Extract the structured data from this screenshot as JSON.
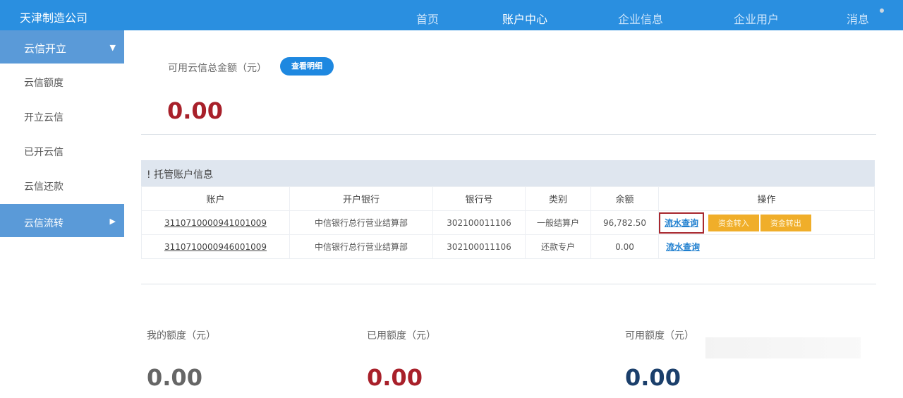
{
  "header": {
    "company": "天津制造公司",
    "nav": [
      "首页",
      "账户中心",
      "企业信息",
      "企业用户",
      "消息"
    ]
  },
  "sidebar": {
    "section": "云信开立",
    "items": [
      "云信额度",
      "开立云信",
      "已开云信",
      "云信还款"
    ],
    "active": "云信流转"
  },
  "summary": {
    "label": "可用云信总金额（元）",
    "detail_button": "查看明细",
    "amount": "0.00"
  },
  "accounts": {
    "title": "托管账户信息",
    "columns": [
      "账户",
      "开户银行",
      "银行号",
      "类别",
      "余额",
      "操作"
    ],
    "rows": [
      {
        "account": "3110710000941001009",
        "bank": "中信银行总行营业结算部",
        "bank_no": "302100011106",
        "type": "一般结算户",
        "balance": "96,782.50",
        "actions": [
          "流水查询",
          "资金转入",
          "资金转出"
        ]
      },
      {
        "account": "3110710000946001009",
        "bank": "中信银行总行营业结算部",
        "bank_no": "302100011106",
        "type": "还款专户",
        "balance": "0.00",
        "actions": [
          "流水查询"
        ]
      }
    ]
  },
  "quota": {
    "mine_label": "我的额度（元）",
    "mine": "0.00",
    "used_label": "已用额度（元）",
    "used": "0.00",
    "avail_label": "可用额度（元）",
    "avail": "0.00"
  },
  "colors": {
    "header": "#2a8fe0",
    "red": "#a8202a",
    "navy": "#1b3f6b",
    "grey": "#666"
  }
}
